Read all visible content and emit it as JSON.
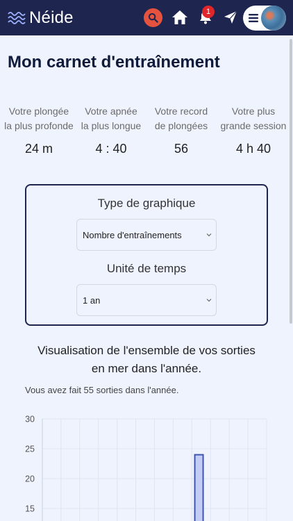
{
  "nav": {
    "brand": "Néide",
    "notification_count": "1",
    "icons": [
      "search-icon",
      "home-icon",
      "bell-icon",
      "send-icon",
      "menu-icon"
    ]
  },
  "page": {
    "title": "Mon carnet d'entraînement"
  },
  "stats": [
    {
      "label_line1": "Votre plongée",
      "label_line2": "la plus profonde",
      "value": "24 m"
    },
    {
      "label_line1": "Votre apnée",
      "label_line2": "la plus longue",
      "value": "4 : 40"
    },
    {
      "label_line1": "Votre record",
      "label_line2": "de plongées",
      "value": "56"
    },
    {
      "label_line1": "Votre plus",
      "label_line2": "grande session",
      "value": "4 h 40"
    }
  ],
  "filters": {
    "chart_type_label": "Type de graphique",
    "chart_type_value": "Nombre d'entraînements",
    "time_unit_label": "Unité de temps",
    "time_unit_value": "1 an"
  },
  "visualization": {
    "title_line1": "Visualisation de l'ensemble de vos sorties",
    "title_line2": "en mer dans l'année.",
    "summary": "Vous avez fait 55 sorties dans l'année."
  },
  "colors": {
    "navbar": "#1e2650",
    "accent": "#e5533f",
    "bar_fill": "#c3cdf4",
    "bar_stroke": "#3f56b0"
  },
  "chart_data": {
    "type": "bar",
    "ylim": [
      0,
      30
    ],
    "yticks": [
      "30",
      "25",
      "20",
      "15"
    ],
    "grid": true,
    "categories": [
      "",
      "",
      "",
      "",
      "",
      "",
      "",
      "",
      "",
      "",
      "",
      "",
      ""
    ],
    "values": [
      0,
      0,
      0,
      0,
      0,
      0,
      0,
      0,
      24,
      0,
      0,
      0,
      0
    ]
  }
}
